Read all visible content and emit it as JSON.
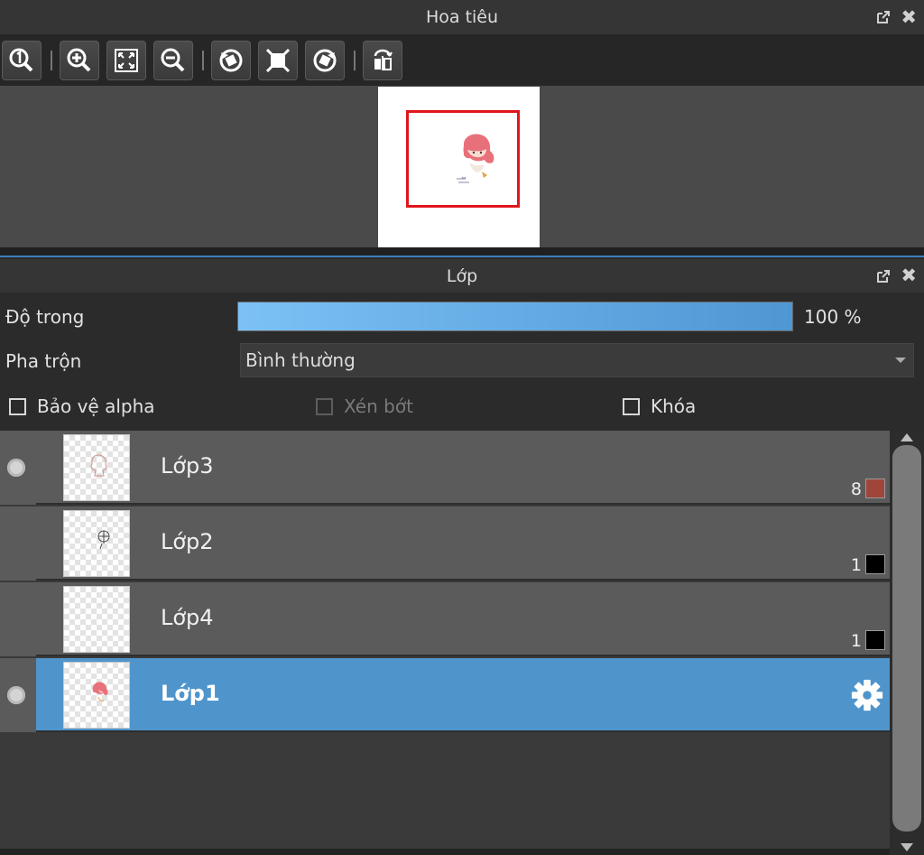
{
  "navigator": {
    "title": "Hoa tiêu",
    "toolbar": [
      {
        "icon": "zoom-actual-icon"
      },
      {
        "icon": "zoom-in-icon"
      },
      {
        "icon": "fit-screen-icon"
      },
      {
        "icon": "zoom-out-icon"
      },
      {
        "icon": "rotate-left-icon"
      },
      {
        "icon": "reset-rotation-icon"
      },
      {
        "icon": "rotate-right-icon"
      },
      {
        "icon": "flip-horizontal-icon"
      }
    ],
    "viewport_rect_color": "#e0161c"
  },
  "layers": {
    "title": "Lớp",
    "opacity_label": "Độ trong",
    "opacity_value": "100 %",
    "opacity_level": 1.0,
    "blend_label": "Pha trộn",
    "blend_value": "Bình thường",
    "options": {
      "protect_alpha": "Bảo vệ alpha",
      "clipping": "Xén bớt",
      "lock": "Khóa"
    },
    "items": [
      {
        "name": "Lớp3",
        "number": "8",
        "color": "#a0453a",
        "visible": true,
        "active": false
      },
      {
        "name": "Lớp2",
        "number": "1",
        "color": "#000000",
        "visible": false,
        "active": false
      },
      {
        "name": "Lớp4",
        "number": "1",
        "color": "#000000",
        "visible": false,
        "active": false
      },
      {
        "name": "Lớp1",
        "number": "",
        "color": "",
        "visible": true,
        "active": true
      }
    ],
    "active_color": "#4f95cc"
  }
}
